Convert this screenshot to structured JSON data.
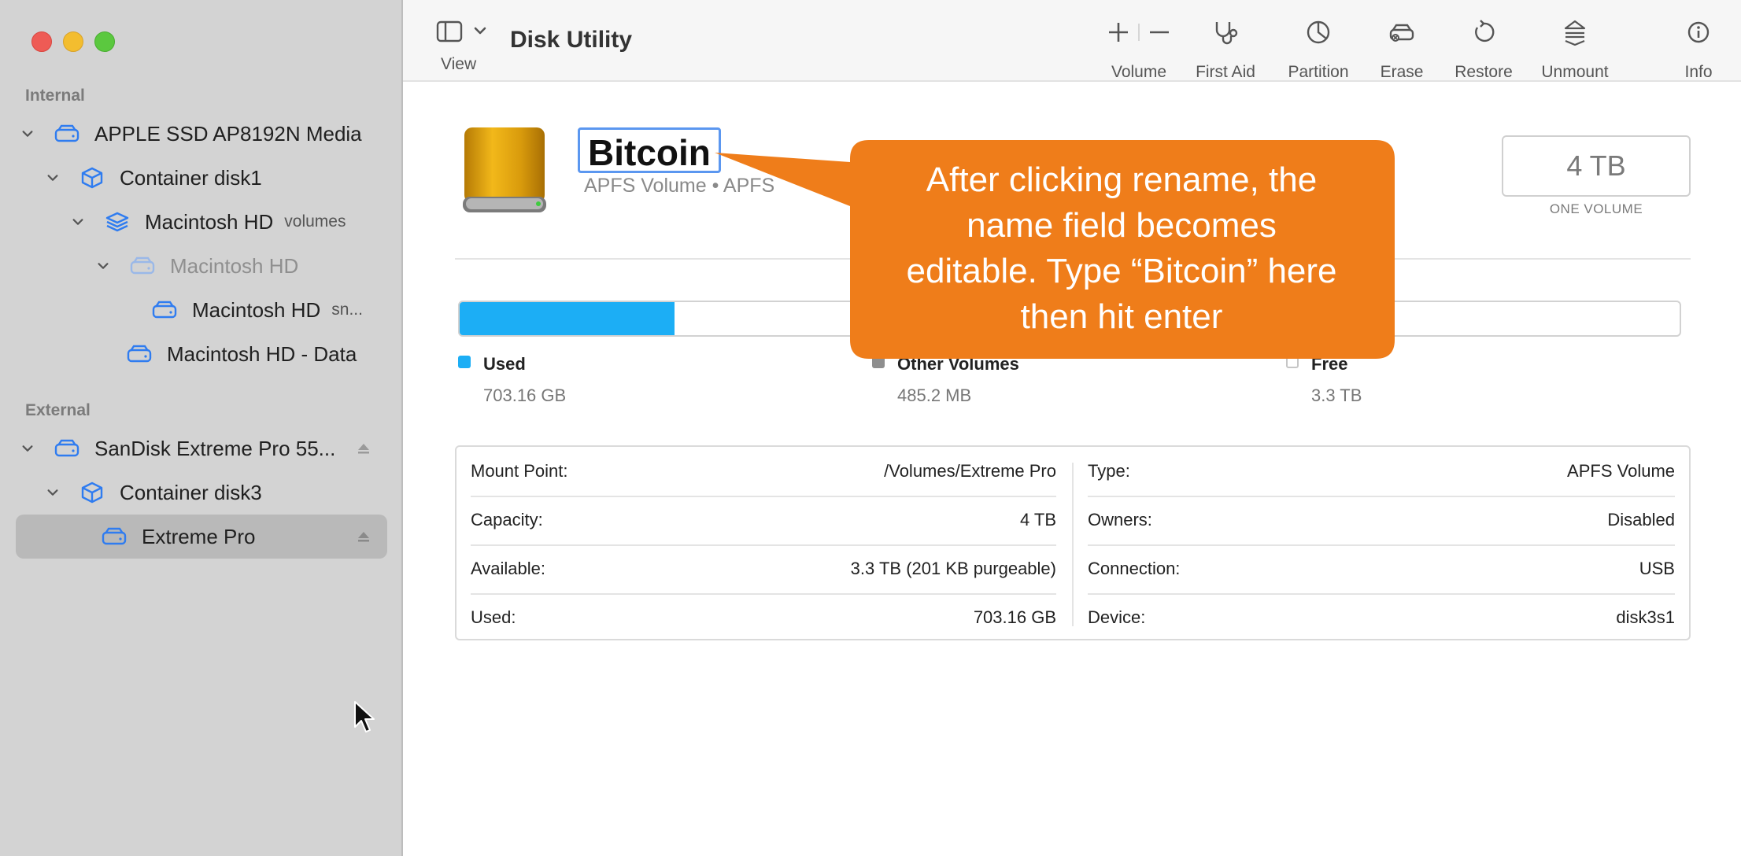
{
  "window": {
    "title": "Disk Utility"
  },
  "toolbar": {
    "view_label": "View",
    "items": [
      {
        "label": "Volume",
        "icon": "plus-minus-icon"
      },
      {
        "label": "First Aid",
        "icon": "stethoscope-icon"
      },
      {
        "label": "Partition",
        "icon": "pie-chart-icon"
      },
      {
        "label": "Erase",
        "icon": "erase-icon"
      },
      {
        "label": "Restore",
        "icon": "restore-icon"
      },
      {
        "label": "Unmount",
        "icon": "unmount-icon"
      },
      {
        "label": "Info",
        "icon": "info-icon"
      }
    ]
  },
  "sidebar": {
    "internal_label": "Internal",
    "external_label": "External",
    "internal": [
      {
        "label": "APPLE SSD AP8192N Media",
        "icon": "drive-icon"
      },
      {
        "label": "Container disk1",
        "icon": "container-icon"
      },
      {
        "label": "Macintosh HD",
        "tag": "volumes",
        "icon": "layers-icon"
      },
      {
        "label": "Macintosh HD",
        "icon": "drive-icon"
      },
      {
        "label": "Macintosh HD",
        "tag": "sn...",
        "icon": "drive-icon"
      },
      {
        "label": "Macintosh HD - Data",
        "icon": "drive-icon"
      }
    ],
    "external": [
      {
        "label": "SanDisk Extreme Pro 55...",
        "icon": "drive-icon"
      },
      {
        "label": "Container disk3",
        "icon": "container-icon"
      },
      {
        "label": "Extreme Pro",
        "icon": "drive-icon"
      }
    ]
  },
  "volume": {
    "name": "Bitcoin",
    "subtitle": "APFS Volume • APFS",
    "size": "4 TB",
    "size_caption": "ONE VOLUME"
  },
  "usage": {
    "used_fraction": 0.176,
    "colors": {
      "used": "#1caef5",
      "other": "#8e8e8e",
      "free": "#ffffff"
    },
    "legend": [
      {
        "name": "Used",
        "value": "703.16 GB"
      },
      {
        "name": "Other Volumes",
        "value": "485.2 MB"
      },
      {
        "name": "Free",
        "value": "3.3 TB"
      }
    ]
  },
  "info": {
    "left": [
      {
        "key": "Mount Point:",
        "value": "/Volumes/Extreme Pro"
      },
      {
        "key": "Capacity:",
        "value": "4 TB"
      },
      {
        "key": "Available:",
        "value": "3.3 TB (201 KB purgeable)"
      },
      {
        "key": "Used:",
        "value": "703.16 GB"
      }
    ],
    "right": [
      {
        "key": "Type:",
        "value": "APFS Volume"
      },
      {
        "key": "Owners:",
        "value": "Disabled"
      },
      {
        "key": "Connection:",
        "value": "USB"
      },
      {
        "key": "Device:",
        "value": "disk3s1"
      }
    ]
  },
  "callout": {
    "text_lines": [
      "After clicking rename, the",
      "name field becomes",
      "editable. Type “Bitcoin” here",
      "then hit enter"
    ],
    "color": "#ef7d1a"
  }
}
